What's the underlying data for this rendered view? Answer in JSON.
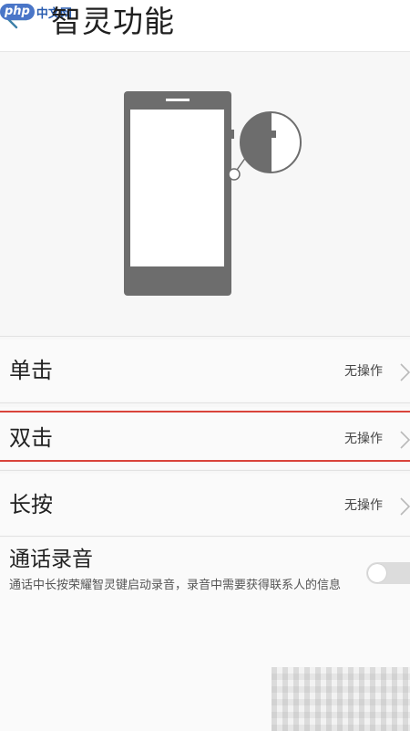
{
  "header": {
    "title": "智灵功能",
    "watermark_logo": "php",
    "watermark_text": "中文网"
  },
  "rows": [
    {
      "label": "单击",
      "value": "无操作"
    },
    {
      "label": "双击",
      "value": "无操作"
    },
    {
      "label": "长按",
      "value": "无操作"
    }
  ],
  "call_recording": {
    "title": "通话录音",
    "description": "通话中长按荣耀智灵键启动录音，录音中需要获得联系人的信息",
    "toggle_on": false
  },
  "colors": {
    "phone_gray": "#6d6d6d",
    "highlight_red": "#d9443b",
    "back_arrow": "#3c7fa8"
  }
}
